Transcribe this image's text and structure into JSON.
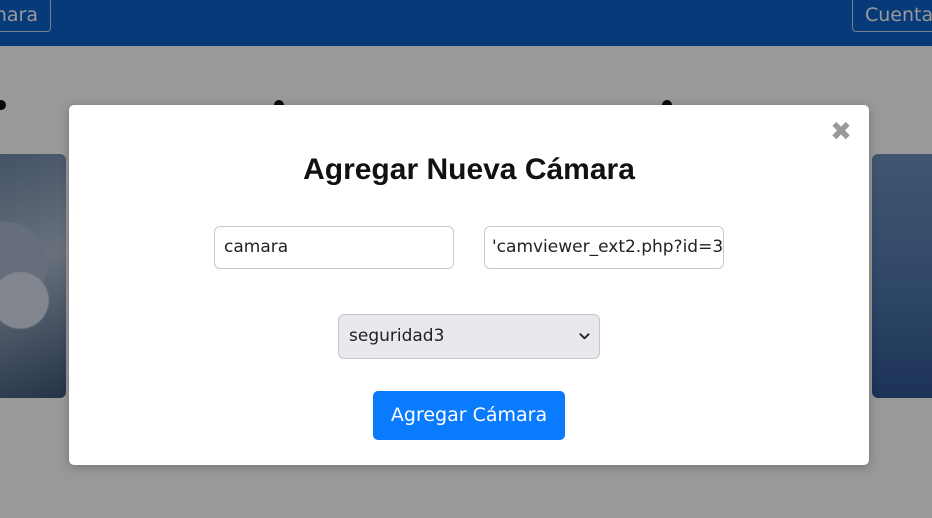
{
  "app": {
    "nav": {
      "left_button_label": "nara",
      "right_button_label": "Cuenta"
    }
  },
  "modal": {
    "title": "Agregar Nueva Cámara",
    "name_input": {
      "value": "camara"
    },
    "url_input": {
      "value": "'camviewer_ext2.php?id=3"
    },
    "group_select": {
      "selected": "seguridad3"
    },
    "submit_label": "Agregar Cámara",
    "close_icon": "close-icon"
  },
  "colors": {
    "nav_background": "#0a62c9",
    "primary_button": "#0a7bff",
    "overlay": "rgba(0,0,0,0.4)"
  }
}
